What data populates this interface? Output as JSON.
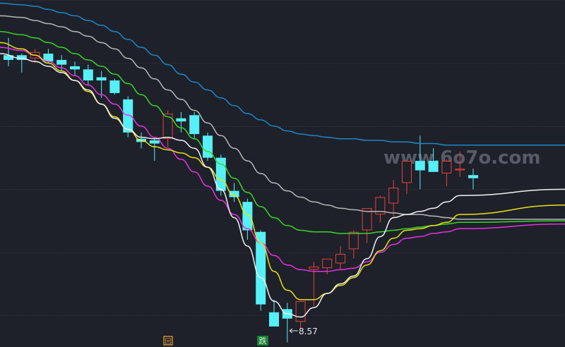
{
  "chart_data": {
    "type": "candlestick",
    "colors": {
      "background": "#1e212a",
      "grid": "#2c313c",
      "up": "#e8413a",
      "down": "#55f0f8",
      "annotation": "#e8e8e8",
      "marker_box": "#e79a3c",
      "fall_tag_bg": "#1d7f33",
      "fall_tag_text": "#cfeedd",
      "watermark": "#6a6f7a"
    },
    "ylim": [
      6,
      28
    ],
    "grid_y": [
      28,
      24,
      20,
      16,
      12,
      8
    ],
    "candles": [
      {
        "o": 24.5,
        "h": 25.6,
        "l": 23.8,
        "c": 24.2
      },
      {
        "o": 24.5,
        "h": 24.6,
        "l": 23.4,
        "c": 24.2
      },
      {
        "o": 24.3,
        "h": 24.9,
        "l": 24.0,
        "c": 24.7
      },
      {
        "o": 24.6,
        "h": 24.9,
        "l": 24.0,
        "c": 24.1
      },
      {
        "o": 24.2,
        "h": 24.5,
        "l": 23.5,
        "c": 23.9
      },
      {
        "o": 23.8,
        "h": 24.1,
        "l": 23.2,
        "c": 23.6
      },
      {
        "o": 23.6,
        "h": 23.9,
        "l": 22.6,
        "c": 22.9
      },
      {
        "o": 23.1,
        "h": 23.5,
        "l": 21.8,
        "c": 22.9
      },
      {
        "o": 22.9,
        "h": 23.0,
        "l": 22.0,
        "c": 22.1
      },
      {
        "o": 21.7,
        "h": 21.9,
        "l": 19.3,
        "c": 19.6
      },
      {
        "o": 19.2,
        "h": 19.6,
        "l": 18.6,
        "c": 19.0
      },
      {
        "o": 19.1,
        "h": 19.3,
        "l": 17.8,
        "c": 18.9
      },
      {
        "o": 19.2,
        "h": 21.0,
        "l": 18.7,
        "c": 20.8
      },
      {
        "o": 20.5,
        "h": 20.9,
        "l": 19.6,
        "c": 20.3
      },
      {
        "o": 20.7,
        "h": 20.9,
        "l": 19.2,
        "c": 19.5
      },
      {
        "o": 19.4,
        "h": 19.6,
        "l": 17.8,
        "c": 18.0
      },
      {
        "o": 18.0,
        "h": 18.2,
        "l": 15.6,
        "c": 15.9
      },
      {
        "o": 15.9,
        "h": 16.4,
        "l": 15.2,
        "c": 15.5
      },
      {
        "o": 15.2,
        "h": 15.4,
        "l": 12.8,
        "c": 13.4
      },
      {
        "o": 13.3,
        "h": 13.4,
        "l": 8.3,
        "c": 8.7
      },
      {
        "o": 8.2,
        "h": 9.0,
        "l": 7.3,
        "c": 7.3
      },
      {
        "o": 8.4,
        "h": 8.8,
        "l": 6.3,
        "c": 7.8
      },
      {
        "o": 7.6,
        "h": 8.8,
        "l": 7.2,
        "c": 8.9
      },
      {
        "o": 10.9,
        "h": 11.4,
        "l": 8.6,
        "c": 11.1
      },
      {
        "o": 11.0,
        "h": 11.6,
        "l": 10.6,
        "c": 11.6
      },
      {
        "o": 11.3,
        "h": 12.4,
        "l": 10.9,
        "c": 11.9
      },
      {
        "o": 12.2,
        "h": 13.4,
        "l": 11.6,
        "c": 13.3
      },
      {
        "o": 13.4,
        "h": 14.6,
        "l": 12.6,
        "c": 14.8
      },
      {
        "o": 14.4,
        "h": 15.6,
        "l": 13.9,
        "c": 15.5
      },
      {
        "o": 15.1,
        "h": 16.6,
        "l": 14.2,
        "c": 16.1
      },
      {
        "o": 16.4,
        "h": 17.6,
        "l": 15.7,
        "c": 17.8
      },
      {
        "o": 17.8,
        "h": 19.4,
        "l": 16.0,
        "c": 17.2
      },
      {
        "o": 17.8,
        "h": 18.6,
        "l": 17.1,
        "c": 17.1
      },
      {
        "o": 17.0,
        "h": 17.9,
        "l": 16.2,
        "c": 17.8
      },
      {
        "o": 17.2,
        "h": 18.4,
        "l": 16.8,
        "c": 17.3
      },
      {
        "o": 16.9,
        "h": 17.3,
        "l": 16.0,
        "c": 16.7
      }
    ],
    "min_label": "8.57",
    "tags": {
      "marker": "回",
      "fall": "跌"
    },
    "watermark": "www.6o7o.com",
    "ma_lines": [
      {
        "color": "#1c87c6",
        "values": [
          27.8,
          27.7,
          27.6,
          27.4,
          27.2,
          27.0,
          26.7,
          26.4,
          26.0,
          25.5,
          25.0,
          24.5,
          23.9,
          23.3,
          22.8,
          22.3,
          21.8,
          21.3,
          20.8,
          20.4,
          20.0,
          19.7,
          19.5,
          19.4,
          19.3,
          19.2,
          19.2,
          19.1,
          19.1,
          19.0,
          19.0,
          18.9,
          18.9,
          18.8,
          18.8,
          18.8
        ]
      },
      {
        "color": "#b8b8b8",
        "values": [
          27.0,
          26.9,
          26.7,
          26.5,
          26.3,
          26.0,
          25.7,
          25.3,
          24.9,
          24.3,
          23.7,
          23.0,
          22.3,
          21.7,
          21.0,
          20.2,
          19.4,
          18.6,
          17.8,
          17.0,
          16.4,
          15.9,
          15.5,
          15.2,
          15.0,
          14.8,
          14.7,
          14.6,
          14.6,
          14.5,
          14.4,
          14.4,
          14.3,
          14.2,
          14.1,
          14.1
        ]
      },
      {
        "color": "#38d629",
        "values": [
          26.0,
          25.8,
          25.6,
          25.3,
          25.0,
          24.6,
          24.2,
          23.8,
          23.3,
          22.7,
          22.0,
          21.3,
          20.6,
          19.9,
          19.2,
          18.4,
          17.6,
          16.7,
          15.8,
          14.9,
          14.2,
          13.7,
          13.4,
          13.3,
          13.3,
          13.2,
          13.2,
          13.2,
          13.3,
          13.4,
          13.5,
          13.6,
          13.7,
          13.8,
          13.9,
          14.0
        ]
      },
      {
        "color": "#e532e0",
        "values": [
          25.0,
          24.8,
          24.5,
          24.1,
          23.7,
          23.2,
          22.6,
          22.0,
          21.4,
          20.7,
          20.0,
          19.3,
          18.6,
          17.9,
          17.1,
          16.2,
          15.3,
          14.4,
          13.5,
          12.6,
          11.8,
          11.2,
          10.9,
          10.8,
          10.8,
          10.9,
          11.0,
          11.4,
          12.0,
          12.5,
          12.9,
          13.0,
          13.2,
          13.3,
          13.5,
          13.8
        ]
      },
      {
        "color": "#e9e116",
        "values": [
          25.3,
          24.9,
          24.5,
          24.0,
          23.5,
          22.9,
          22.2,
          21.4,
          20.6,
          19.8,
          19.1,
          18.7,
          18.5,
          18.3,
          18.0,
          17.4,
          16.6,
          15.6,
          14.4,
          12.6,
          10.8,
          9.6,
          9.0,
          9.0,
          9.4,
          9.9,
          10.4,
          11.2,
          12.1,
          12.9,
          13.4,
          13.5,
          13.7,
          13.9,
          14.4,
          15.0
        ]
      },
      {
        "color": "#f2f2f2",
        "values": [
          24.6,
          24.3,
          24.1,
          23.8,
          23.4,
          22.9,
          22.3,
          21.4,
          20.5,
          19.8,
          19.3,
          19.2,
          19.3,
          19.1,
          18.6,
          17.4,
          16.0,
          14.2,
          12.4,
          10.4,
          8.9,
          8.1,
          7.9,
          8.5,
          9.4,
          10.0,
          10.5,
          11.6,
          13.0,
          14.2,
          14.4,
          14.6,
          14.8,
          15.2,
          15.6,
          16.0
        ]
      }
    ]
  }
}
